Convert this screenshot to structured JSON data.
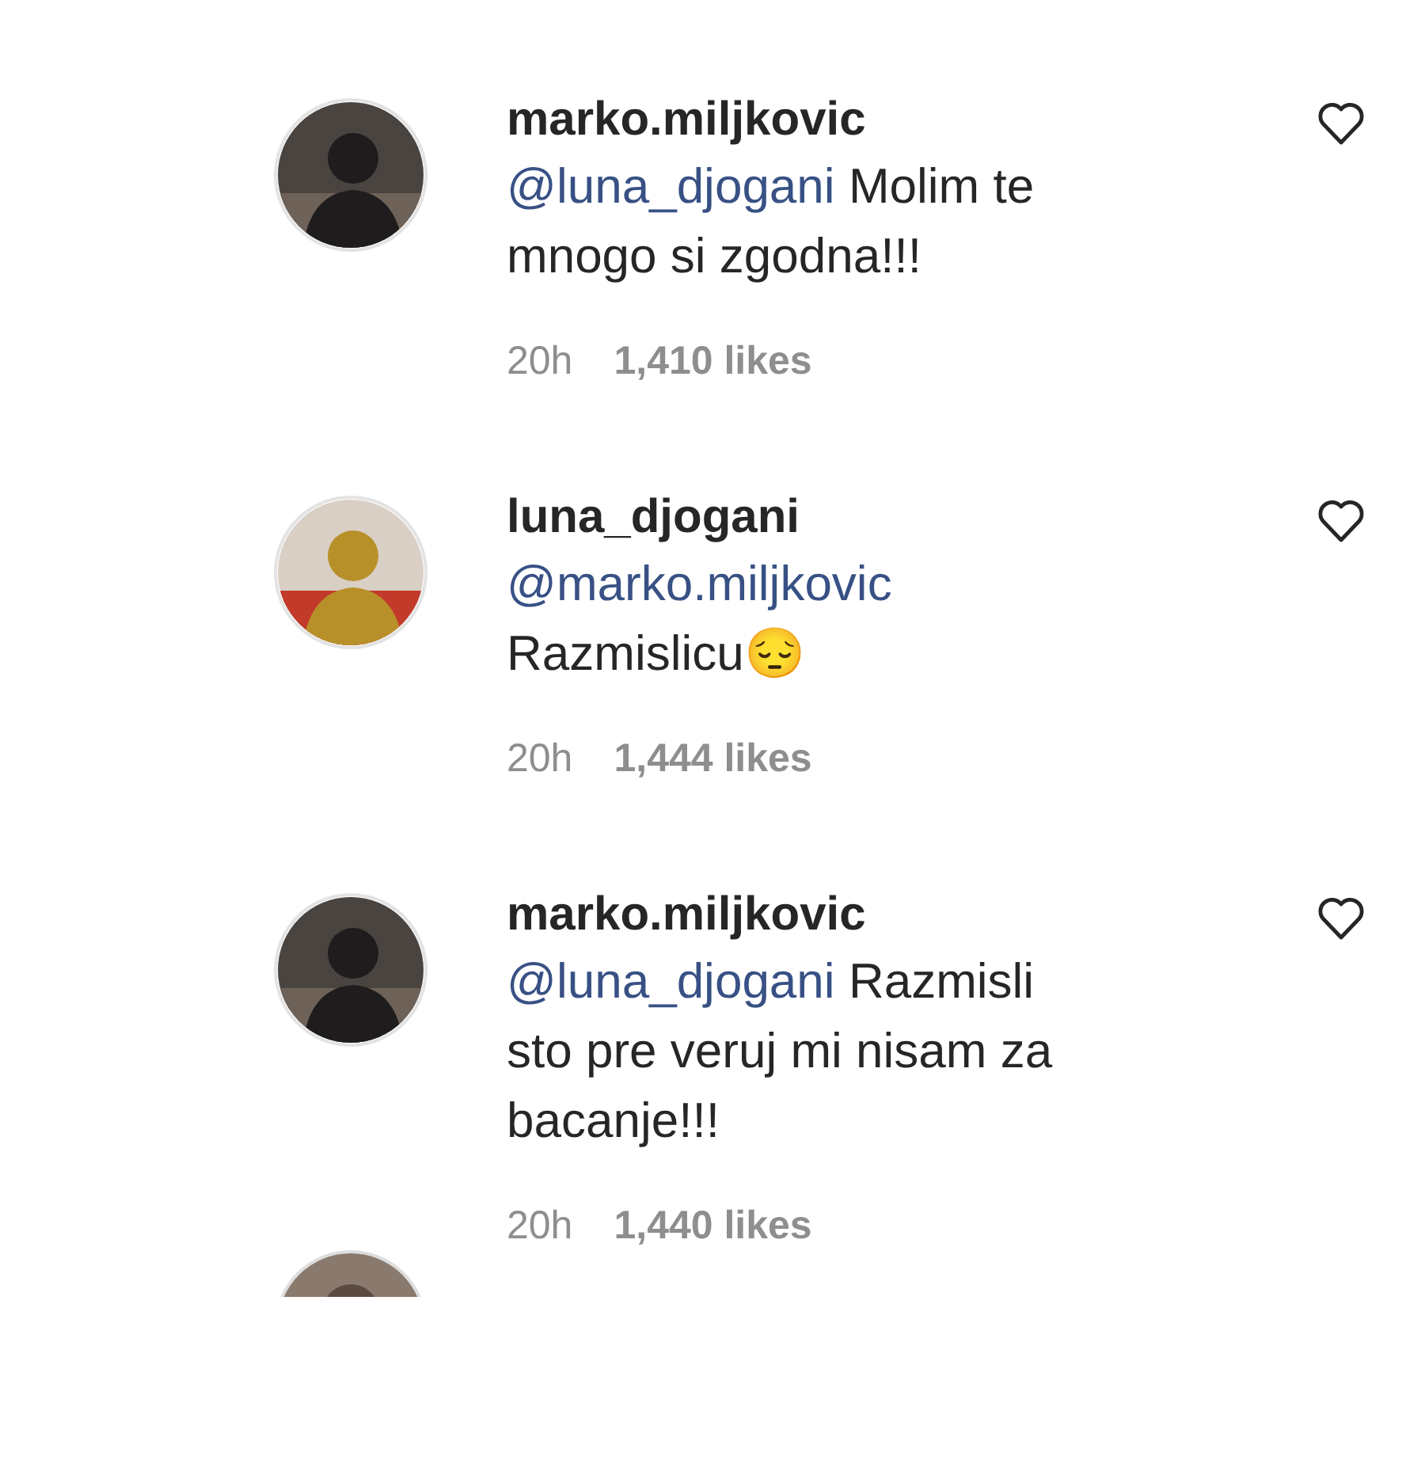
{
  "comments": [
    {
      "username": "marko.miljkovic",
      "lines": [
        {
          "mention": "@luna_djogani",
          "text": "Molim te"
        },
        {
          "text": "mnogo si zgodna!!!"
        }
      ],
      "liked": false,
      "time": "20h",
      "likes": "1,410 likes"
    },
    {
      "username": "luna_djogani",
      "lines": [
        {
          "mention": "@marko.miljkovic"
        },
        {
          "text": "Razmislicu😔"
        }
      ],
      "liked": false,
      "time": "20h",
      "likes": "1,444 likes"
    },
    {
      "username": "marko.miljkovic",
      "lines": [
        {
          "mention": "@luna_djogani",
          "text": "Razmisli"
        },
        {
          "text": "sto pre veruj mi nisam za"
        },
        {
          "text": "bacanje!!!"
        }
      ],
      "liked": false,
      "time": "20h",
      "likes": "1,440 likes"
    }
  ]
}
